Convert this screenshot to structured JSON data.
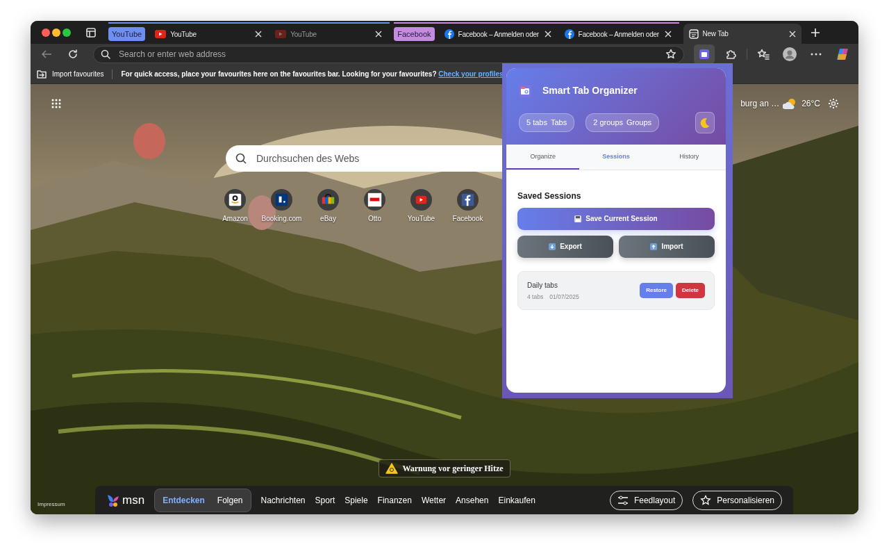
{
  "tab_strip": [
    {
      "kind": "group",
      "label": "YouTube",
      "color": "#6e8ff0",
      "tabs": [
        {
          "kind": "video",
          "title": "YouTube",
          "selected": false,
          "sleeping": false
        },
        {
          "kind": "video",
          "title": "YouTube",
          "selected": false,
          "sleeping": true
        }
      ]
    },
    {
      "kind": "group",
      "label": "Facebook",
      "color": "#c58be0",
      "tabs": [
        {
          "kind": "social",
          "title": "Facebook – Anmelden oder",
          "selected": false,
          "sleeping": false
        },
        {
          "kind": "social",
          "title": "Facebook – Anmelden oder",
          "selected": false,
          "sleeping": false
        }
      ]
    },
    {
      "kind": "tab",
      "tab": {
        "kind": "newtab",
        "title": "New Tab",
        "selected": true,
        "sleeping": false
      }
    }
  ],
  "address_bar": {
    "placeholder": "Search or enter web address"
  },
  "toolbar": {
    "extension_pressed": true
  },
  "favourites_bar": {
    "import_label": "Import favourites",
    "message": "For quick access, place your favourites here on the favourites bar. Looking for your favourites?",
    "link": "Check your profiles"
  },
  "new_tab_page": {
    "weather": {
      "location": "burg an …",
      "temperature": "26°C"
    },
    "search": {
      "placeholder": "Durchsuchen des Webs"
    },
    "quick_links": [
      {
        "kind": "amazon",
        "label": "Amazon"
      },
      {
        "kind": "booking",
        "label": "Booking.com"
      },
      {
        "kind": "ebay",
        "label": "eBay"
      },
      {
        "kind": "otto",
        "label": "Otto"
      },
      {
        "kind": "video",
        "label": "YouTube"
      },
      {
        "kind": "social",
        "label": "Facebook"
      }
    ],
    "alert": "Warnung vor geringer Hitze",
    "footer_link": "Impressum",
    "feed_bar": {
      "logo_text": "msn",
      "tabs": [
        {
          "label": "Entdecken",
          "selected": true
        },
        {
          "label": "Folgen",
          "selected": false
        }
      ],
      "links": [
        "Nachrichten",
        "Sport",
        "Spiele",
        "Finanzen",
        "Wetter",
        "Ansehen",
        "Einkaufen"
      ],
      "buttons": [
        {
          "kind": "layout",
          "label": "Feedlayout"
        },
        {
          "kind": "personalize",
          "label": "Personalisieren"
        }
      ]
    }
  },
  "extension_popup": {
    "title": "Smart Tab Organizer",
    "stats": [
      {
        "value": "5 tabs",
        "label": "Tabs"
      },
      {
        "value": "2 groups",
        "label": "Groups"
      }
    ],
    "tabs": [
      {
        "label": "Organize",
        "selected": false,
        "underlined": true
      },
      {
        "label": "Sessions",
        "selected": true,
        "underlined": false
      },
      {
        "label": "History",
        "selected": false,
        "underlined": false
      }
    ],
    "section_title": "Saved Sessions",
    "save_button": "Save Current Session",
    "actions": [
      {
        "kind": "export",
        "label": "Export"
      },
      {
        "kind": "import",
        "label": "Import"
      }
    ],
    "sessions": [
      {
        "name": "Daily tabs",
        "tab_count": "4 tabs",
        "date": "01/07/2025",
        "restore_label": "Restore",
        "delete_label": "Delete"
      }
    ]
  }
}
